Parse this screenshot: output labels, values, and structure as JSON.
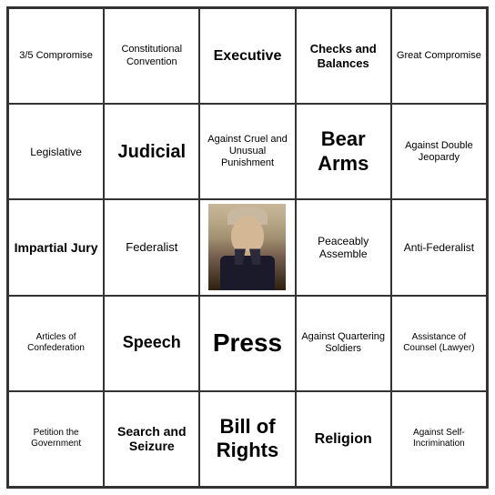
{
  "board": {
    "cells": [
      {
        "id": "r0c0",
        "text": "3/5 Compromise",
        "size": "normal"
      },
      {
        "id": "r0c1",
        "text": "Constitutional Convention",
        "size": "normal"
      },
      {
        "id": "r0c2",
        "text": "Executive",
        "size": "medium"
      },
      {
        "id": "r0c3",
        "text": "Checks and Balances",
        "size": "normal"
      },
      {
        "id": "r0c4",
        "text": "Great Compromise",
        "size": "normal"
      },
      {
        "id": "r1c0",
        "text": "Legislative",
        "size": "normal"
      },
      {
        "id": "r1c1",
        "text": "Judicial",
        "size": "medium"
      },
      {
        "id": "r1c2",
        "text": "Against Cruel and Unusual Punishment",
        "size": "small"
      },
      {
        "id": "r1c3",
        "text": "Bear Arms",
        "size": "large"
      },
      {
        "id": "r1c4",
        "text": "Against Double Jeopardy",
        "size": "normal"
      },
      {
        "id": "r2c0",
        "text": "Impartial Jury",
        "size": "medium"
      },
      {
        "id": "r2c1",
        "text": "Federalist",
        "size": "normal"
      },
      {
        "id": "r2c2",
        "text": "PORTRAIT",
        "size": "portrait"
      },
      {
        "id": "r2c3",
        "text": "Peaceably Assemble",
        "size": "normal"
      },
      {
        "id": "r2c4",
        "text": "Anti-Federalist",
        "size": "normal"
      },
      {
        "id": "r3c0",
        "text": "Articles of Confederation",
        "size": "small"
      },
      {
        "id": "r3c1",
        "text": "Speech",
        "size": "medium"
      },
      {
        "id": "r3c2",
        "text": "Press",
        "size": "large"
      },
      {
        "id": "r3c3",
        "text": "Against Quartering Soldiers",
        "size": "normal"
      },
      {
        "id": "r3c4",
        "text": "Assistance of Counsel (Lawyer)",
        "size": "small"
      },
      {
        "id": "r4c0",
        "text": "Petition the Government",
        "size": "small"
      },
      {
        "id": "r4c1",
        "text": "Search and Seizure",
        "size": "medium"
      },
      {
        "id": "r4c2",
        "text": "Bill of Rights",
        "size": "large"
      },
      {
        "id": "r4c3",
        "text": "Religion",
        "size": "medium"
      },
      {
        "id": "r4c4",
        "text": "Against Self-Incrimination",
        "size": "small"
      }
    ]
  }
}
